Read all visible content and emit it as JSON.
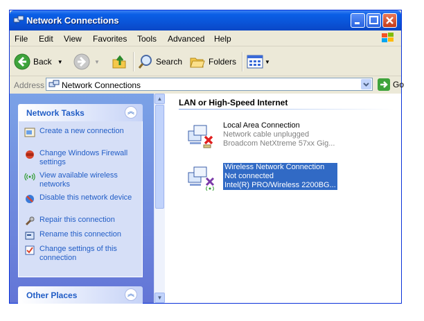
{
  "window": {
    "title": "Network Connections"
  },
  "menu": [
    "File",
    "Edit",
    "View",
    "Favorites",
    "Tools",
    "Advanced",
    "Help"
  ],
  "toolbar": {
    "back_label": "Back",
    "search_label": "Search",
    "folders_label": "Folders"
  },
  "address": {
    "label": "Address",
    "value": "Network Connections",
    "go_label": "Go"
  },
  "left_pane": {
    "network_tasks": {
      "title": "Network Tasks",
      "items": [
        {
          "label": "Create a new connection",
          "icon": "new-connection-icon"
        },
        {
          "label": "Change Windows Firewall settings",
          "icon": "firewall-icon"
        },
        {
          "label": "View available wireless networks",
          "icon": "wireless-icon"
        },
        {
          "label": "Disable this network device",
          "icon": "disable-icon"
        },
        {
          "label": "Repair this connection",
          "icon": "repair-icon"
        },
        {
          "label": "Rename this connection",
          "icon": "rename-icon"
        },
        {
          "label": "Change settings of this connection",
          "icon": "settings-icon"
        }
      ]
    },
    "other_places": {
      "title": "Other Places"
    }
  },
  "main": {
    "group_title": "LAN or High-Speed Internet",
    "connections": [
      {
        "name": "Local Area Connection",
        "status": "Network cable unplugged",
        "device": "Broadcom NetXtreme 57xx Gig...",
        "selected": false
      },
      {
        "name": "Wireless Network Connection",
        "status": "Not connected",
        "device": "Intel(R) PRO/Wireless 2200BG...",
        "selected": true
      }
    ]
  },
  "colors": {
    "titlebar": "#0a54d8",
    "task_link": "#215dc6",
    "selection": "#316ac5"
  }
}
